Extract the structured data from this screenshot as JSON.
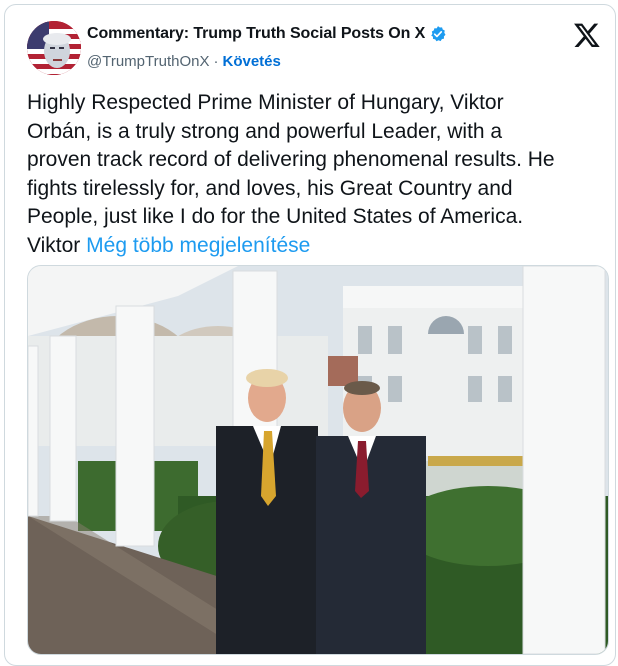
{
  "author": {
    "display_name": "Commentary: Trump Truth Social Posts On X",
    "handle": "@TrumpTruthOnX",
    "separator": "·",
    "follow_label": "Követés",
    "verified": true
  },
  "tweet": {
    "text": "Highly Respected Prime Minister of Hungary, Viktor\nOrbán, is a truly strong and powerful Leader, with a\nproven track record of delivering phenomenal results. He\nfights tirelessly for, and loves, his Great Country and\nPeople, just like I do for the United States of America.\nViktor",
    "show_more_label": "Még több megjelenítése"
  },
  "icons": {
    "platform": "x-logo-icon",
    "verified": "verified-badge-icon"
  },
  "colors": {
    "link": "#1d9bf0",
    "follow": "#006fd6",
    "text": "#0f1419",
    "muted": "#536471",
    "border": "#cfd9de"
  }
}
